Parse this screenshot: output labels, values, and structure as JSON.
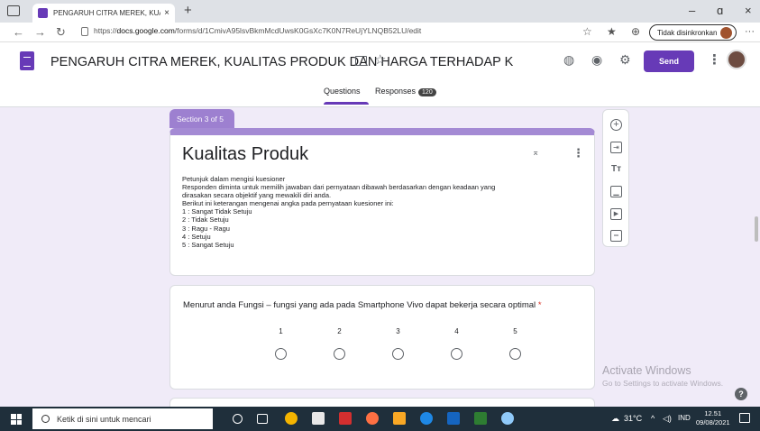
{
  "browser": {
    "tab_title": "PENGARUH CITRA MEREK, KUAL",
    "tab_close": "×",
    "new_tab": "+",
    "url_prefix": "https://",
    "url_domain": "docs.google.com",
    "url_path": "/forms/d/1CmivA95lsvBkmMcdUwsK0GsXc7K0N7ReUjYLNQB52LU/edit",
    "sync_label": "Tidak disinkronkan",
    "more": "···",
    "minimize": "–",
    "restore": "ɑ",
    "close": "×"
  },
  "form": {
    "title": "PENGARUH CITRA MEREK, KUALITAS PRODUK DAN HARGA TERHADAP K",
    "send_label": "Send",
    "tabs": {
      "questions": "Questions",
      "responses": "Responses",
      "responses_count": "120"
    },
    "section_label": "Section 3 of 5",
    "section_title": "Kualitas Produk",
    "description_lines": [
      "Petunjuk dalam mengisi kuesioner",
      "Responden diminta untuk memilih jawaban dari pernyataan dibawah berdasarkan dengan keadaan yang",
      "dirasakan secara objektif yang mewakili diri anda.",
      "Berikut ini keterangan mengenai angka pada pernyataan kuesioner ini:",
      "1 : Sangat Tidak Setuju",
      "2 : Tidak Setuju",
      "3 : Ragu - Ragu",
      "4 : Setuju",
      "5 : Sangat Setuju"
    ],
    "question": {
      "text": "Menurut anda Fungsi – fungsi yang ada pada Smartphone Vivo dapat bekerja secara optimal",
      "required_mark": "*",
      "scale": [
        "1",
        "2",
        "3",
        "4",
        "5"
      ]
    }
  },
  "watermark": {
    "line1": "Activate Windows",
    "line2": "Go to Settings to activate Windows."
  },
  "help": "?",
  "taskbar": {
    "search_placeholder": "Ketik di sini untuk mencari",
    "temperature": "31°C",
    "language": "IND",
    "time": "12.51",
    "date": "09/08/2021"
  }
}
